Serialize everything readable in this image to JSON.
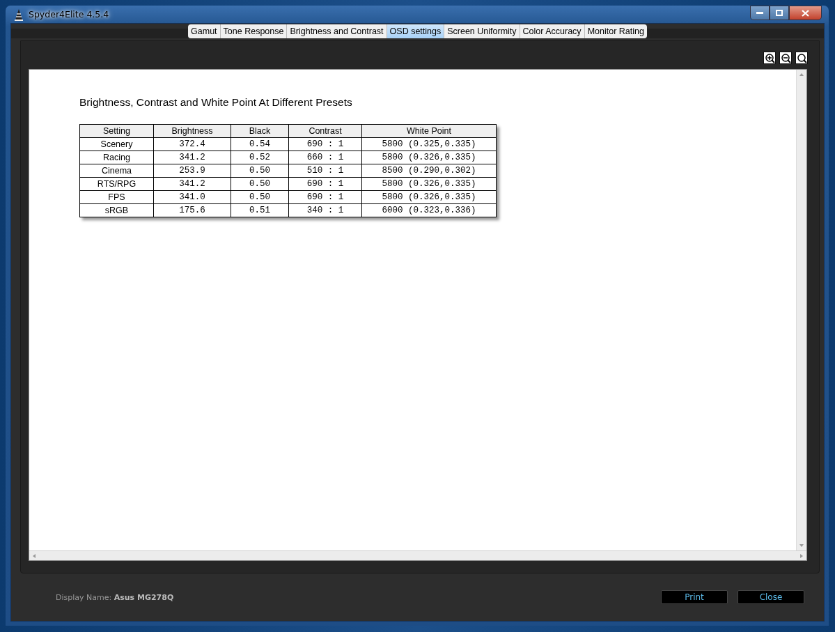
{
  "window": {
    "title": "Spyder4Elite 4.5.4"
  },
  "tabs": [
    {
      "label": "Gamut",
      "selected": false
    },
    {
      "label": "Tone Response",
      "selected": false
    },
    {
      "label": "Brightness and Contrast",
      "selected": false
    },
    {
      "label": "OSD settings",
      "selected": true
    },
    {
      "label": "Screen Uniformity",
      "selected": false
    },
    {
      "label": "Color Accuracy",
      "selected": false
    },
    {
      "label": "Monitor Rating",
      "selected": false
    }
  ],
  "report": {
    "title": "Brightness, Contrast and White Point At Different Presets",
    "table": {
      "columns": [
        "Setting",
        "Brightness",
        "Black",
        "Contrast",
        "White Point"
      ],
      "rows": [
        [
          "Scenery",
          "372.4",
          "0.54",
          "690 : 1",
          "5800 (0.325,0.335)"
        ],
        [
          "Racing",
          "341.2",
          "0.52",
          "660 : 1",
          "5800 (0.326,0.335)"
        ],
        [
          "Cinema",
          "253.9",
          "0.50",
          "510 : 1",
          "8500 (0.290,0.302)"
        ],
        [
          "RTS/RPG",
          "341.2",
          "0.50",
          "690 : 1",
          "5800 (0.326,0.335)"
        ],
        [
          "FPS",
          "341.0",
          "0.50",
          "690 : 1",
          "5800 (0.326,0.335)"
        ],
        [
          "sRGB",
          "175.6",
          "0.51",
          "340 : 1",
          "6000 (0.323,0.336)"
        ]
      ]
    }
  },
  "footer": {
    "display_name": "Display Name: **Asus MG278Q**",
    "buttons": [
      "Print",
      "Close"
    ]
  }
}
